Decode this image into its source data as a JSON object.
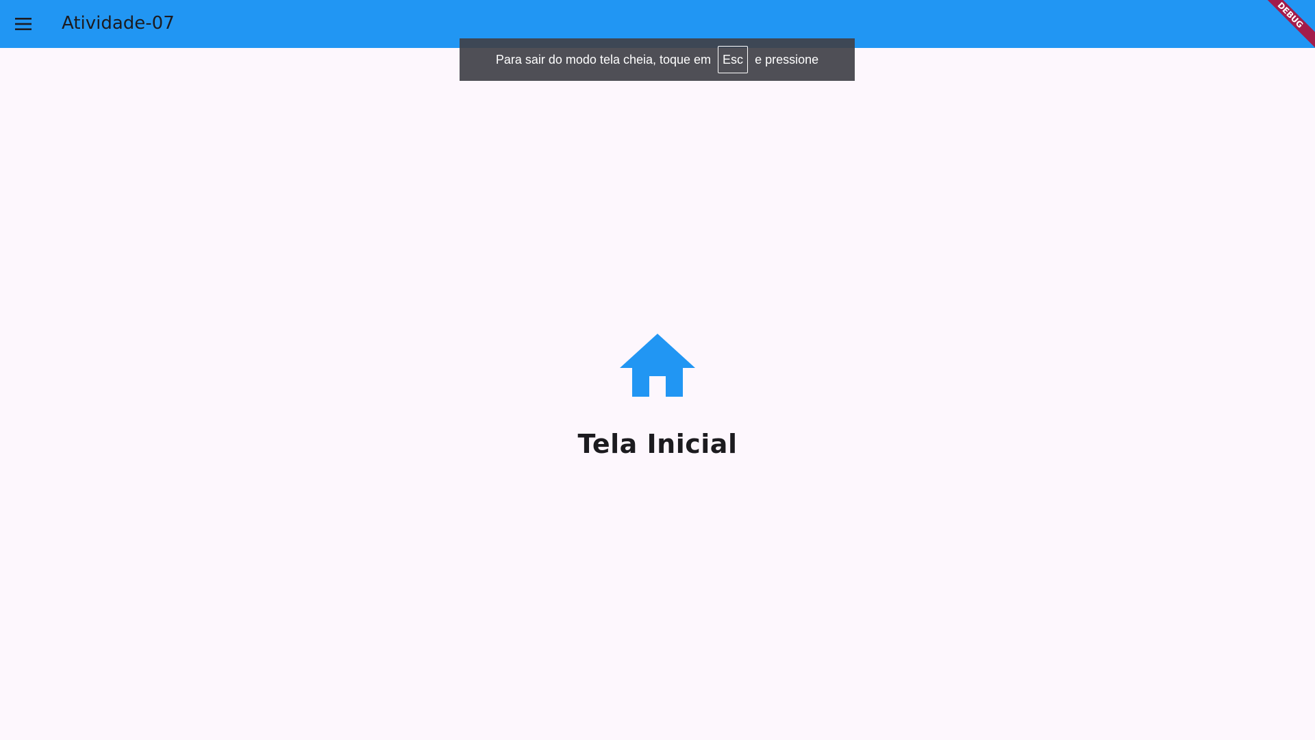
{
  "appbar": {
    "title": "Atividade-07",
    "menu_icon": "menu-icon",
    "background_color": "#2196f3"
  },
  "debug_banner": {
    "label": "DEBUG",
    "color": "#a31c4b"
  },
  "fullscreen_toast": {
    "text_before": "Para sair do modo tela cheia, toque em",
    "key_label": "Esc",
    "text_after": "e pressione"
  },
  "main": {
    "icon": "home-icon",
    "icon_color": "#2196f3",
    "heading": "Tela Inicial"
  }
}
